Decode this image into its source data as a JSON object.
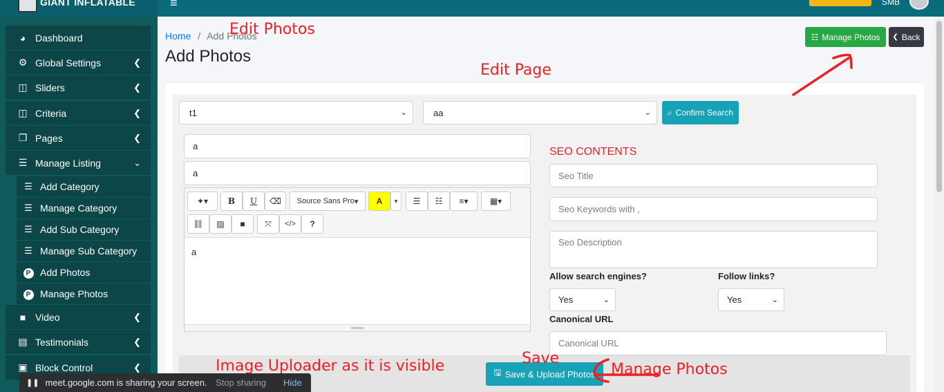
{
  "app": {
    "brand": "GIANT INFLATABLE",
    "user": "SMB"
  },
  "sidebar": {
    "items": [
      {
        "label": "Dashboard",
        "icon": "dashboard-icon"
      },
      {
        "label": "Global Settings",
        "icon": "cogs-icon"
      },
      {
        "label": "Sliders",
        "icon": "columns-icon"
      },
      {
        "label": "Criteria",
        "icon": "columns-icon"
      },
      {
        "label": "Pages",
        "icon": "copy-icon"
      },
      {
        "label": "Manage Listing",
        "icon": "list-icon"
      },
      {
        "label": "Video",
        "icon": "video-icon"
      },
      {
        "label": "Testimonials",
        "icon": "id-card-icon"
      },
      {
        "label": "Block Control",
        "icon": "block-icon"
      }
    ],
    "sub_items": [
      {
        "label": "Add Category"
      },
      {
        "label": "Manage Category"
      },
      {
        "label": "Add Sub Category"
      },
      {
        "label": "Manage Sub Category"
      },
      {
        "label": "Add Photos"
      },
      {
        "label": "Manage Photos"
      }
    ]
  },
  "breadcrumb": {
    "home": "Home",
    "separator": "/",
    "current": "Add Photos"
  },
  "page_title": "Add Photos",
  "header_buttons": {
    "manage": "Manage Photos",
    "back": "Back"
  },
  "search": {
    "select1": "t1",
    "select2": "aa",
    "confirm": "Confirm Search"
  },
  "form": {
    "field1": "a",
    "field2": "a",
    "editor_content": "a",
    "font_name": "Source Sans Pro",
    "save_button": "Save & Upload Photos"
  },
  "seo": {
    "heading": "SEO CONTENTS",
    "title_placeholder": "Seo Title",
    "keywords_placeholder": "Seo Keywords with ,",
    "description_placeholder": "Seo Description",
    "allow_label": "Allow search engines?",
    "allow_value": "Yes",
    "follow_label": "Follow links?",
    "follow_value": "Yes",
    "canonical_label": "Canonical URL",
    "canonical_placeholder": "Canonical URL"
  },
  "annotations": {
    "edit_photos": "Edit Photos",
    "edit_page": "Edit Page",
    "image_uploader": "Image Uploader as it is visible",
    "save": "Save",
    "manage_photos": "Manage Photos"
  },
  "share_bar": {
    "message": "meet.google.com is sharing your screen.",
    "stop": "Stop sharing",
    "hide": "Hide"
  },
  "colors": {
    "accent": "#17a2b8",
    "success": "#28a745",
    "sidebar": "#0d4648",
    "annotation": "#ee1f25"
  }
}
